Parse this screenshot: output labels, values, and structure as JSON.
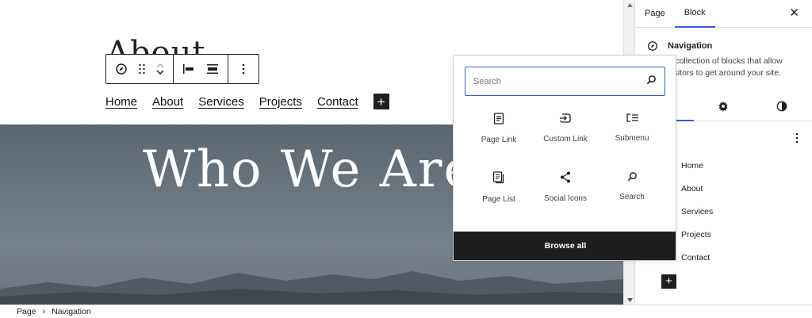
{
  "canvas": {
    "site_title": "About",
    "nav_links": [
      "Home",
      "About",
      "Services",
      "Projects",
      "Contact"
    ],
    "hero_heading": "Who We Are?"
  },
  "toolbar": {
    "block_type_icon": "navigation-compass-icon",
    "drag_icon": "drag-handle-icon",
    "move_up_icon": "chevron-up-icon",
    "move_down_icon": "chevron-down-icon",
    "justify_icon": "justify-left-icon",
    "align_icon": "align-wide-icon",
    "options_icon": "more-vertical-icon"
  },
  "inserter": {
    "search_placeholder": "Search",
    "items": [
      {
        "label": "Page Link",
        "icon": "page-icon"
      },
      {
        "label": "Custom Link",
        "icon": "custom-link-icon"
      },
      {
        "label": "Submenu",
        "icon": "submenu-icon"
      },
      {
        "label": "Page List",
        "icon": "page-list-icon"
      },
      {
        "label": "Social Icons",
        "icon": "share-icon"
      },
      {
        "label": "Search",
        "icon": "search-icon"
      }
    ],
    "browse_all": "Browse all"
  },
  "sidebar": {
    "tabs": [
      "Page",
      "Block"
    ],
    "active_tab": "Block",
    "block_title": "Navigation",
    "block_desc": "A collection of blocks that allow visitors to get around your site.",
    "menu_items": [
      "Home",
      "About",
      "Services",
      "Projects",
      "Contact"
    ]
  },
  "footer": {
    "breadcrumb": [
      "Page",
      "Navigation"
    ]
  },
  "colors": {
    "accent": "#3858e9",
    "dark": "#1e1e1e"
  }
}
